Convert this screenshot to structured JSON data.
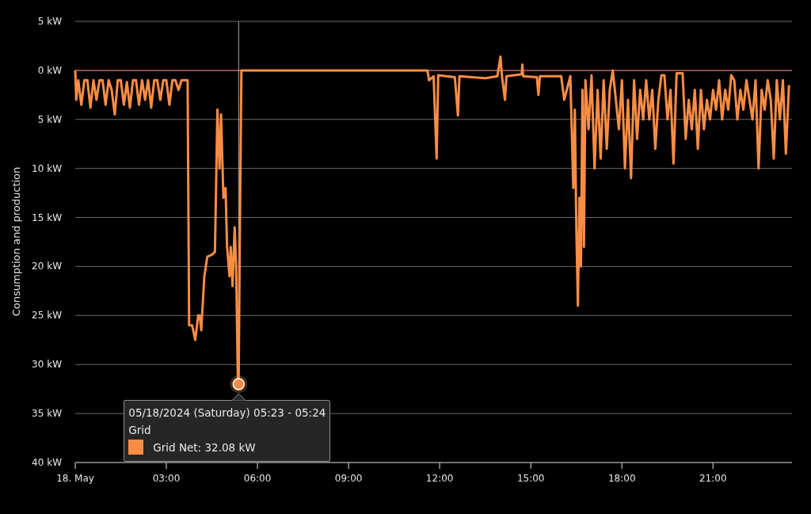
{
  "chart_data": {
    "type": "line",
    "ylabel": "Consumption and production",
    "xlim": [
      0,
      23.6
    ],
    "ylim": [
      -40,
      5
    ],
    "grid": true,
    "ref_lines": [
      {
        "axis": "y",
        "value": 0,
        "color": "#b25252"
      },
      {
        "axis": "x",
        "value": 5.38,
        "color": "#aaaaaa"
      }
    ],
    "xticks": [
      {
        "value": 0,
        "label": "18. May"
      },
      {
        "value": 3,
        "label": "03:00"
      },
      {
        "value": 6,
        "label": "06:00"
      },
      {
        "value": 9,
        "label": "09:00"
      },
      {
        "value": 12,
        "label": "12:00"
      },
      {
        "value": 15,
        "label": "15:00"
      },
      {
        "value": 18,
        "label": "18:00"
      },
      {
        "value": 21,
        "label": "21:00"
      }
    ],
    "yticks": [
      {
        "value": 5,
        "label": "5 kW"
      },
      {
        "value": 0,
        "label": "0 kW"
      },
      {
        "value": -5,
        "label": "5 kW"
      },
      {
        "value": -10,
        "label": "10 kW"
      },
      {
        "value": -15,
        "label": "15 kW"
      },
      {
        "value": -20,
        "label": "20 kW"
      },
      {
        "value": -25,
        "label": "25 kW"
      },
      {
        "value": -30,
        "label": "30 kW"
      },
      {
        "value": -35,
        "label": "35 kW"
      },
      {
        "value": -40,
        "label": "40 kW"
      }
    ],
    "x": [
      0,
      0.03,
      0.1,
      0.2,
      0.3,
      0.4,
      0.5,
      0.6,
      0.7,
      0.8,
      0.9,
      1.0,
      1.1,
      1.2,
      1.3,
      1.4,
      1.5,
      1.6,
      1.7,
      1.8,
      1.9,
      2.0,
      2.1,
      2.2,
      2.3,
      2.4,
      2.5,
      2.6,
      2.7,
      2.8,
      2.9,
      3.0,
      3.1,
      3.2,
      3.3,
      3.4,
      3.5,
      3.6,
      3.7,
      3.75,
      3.85,
      3.95,
      4.05,
      4.1,
      4.15,
      4.25,
      4.35,
      4.5,
      4.6,
      4.68,
      4.75,
      4.8,
      4.88,
      4.95,
      5.0,
      5.08,
      5.12,
      5.18,
      5.25,
      5.3,
      5.35,
      5.38,
      5.42,
      5.47,
      11.6,
      11.65,
      11.8,
      11.9,
      11.95,
      12.5,
      12.6,
      12.65,
      13.5,
      13.9,
      14.0,
      14.05,
      14.15,
      14.2,
      14.7,
      14.72,
      14.75,
      15.2,
      15.25,
      15.3,
      16.0,
      16.1,
      16.3,
      16.4,
      16.45,
      16.5,
      16.55,
      16.6,
      16.65,
      16.7,
      16.75,
      16.8,
      16.9,
      17.0,
      17.1,
      17.2,
      17.3,
      17.4,
      17.5,
      17.6,
      17.7,
      17.8,
      17.9,
      18.0,
      18.1,
      18.2,
      18.3,
      18.4,
      18.5,
      18.6,
      18.7,
      18.8,
      18.9,
      19.0,
      19.1,
      19.2,
      19.3,
      19.4,
      19.5,
      19.6,
      19.7,
      19.8,
      20.0,
      20.1,
      20.2,
      20.3,
      20.4,
      20.5,
      20.6,
      20.7,
      20.8,
      20.9,
      21.0,
      21.1,
      21.2,
      21.3,
      21.4,
      21.5,
      21.6,
      21.7,
      21.8,
      21.9,
      22.0,
      22.1,
      22.2,
      22.3,
      22.4,
      22.5,
      22.6,
      22.7,
      22.8,
      22.9,
      23.0,
      23.1,
      23.2,
      23.3,
      23.4,
      23.5
    ],
    "series": [
      {
        "name": "Grid Net",
        "color": "#f98d45",
        "values": [
          0,
          -3,
          -1,
          -3.5,
          -1,
          -1,
          -3.8,
          -1,
          -3,
          -1,
          -1,
          -3.5,
          -1,
          -2,
          -4.5,
          -1,
          -1,
          -3.5,
          -1.2,
          -3.8,
          -1,
          -1,
          -3.5,
          -1,
          -3,
          -1,
          -3.8,
          -1,
          -1,
          -3,
          -1,
          -1,
          -3.5,
          -1,
          -1,
          -2,
          -1,
          -1,
          -1,
          -26,
          -26,
          -27.5,
          -25,
          -25,
          -26.5,
          -21,
          -19,
          -18.8,
          -18.5,
          -4,
          -10,
          -4.5,
          -13,
          -12,
          -18,
          -21,
          -18,
          -22,
          -16,
          -20,
          -31,
          -32,
          -17,
          0,
          0,
          -1,
          -0.6,
          -9,
          -0.5,
          -0.7,
          -4.6,
          -0.6,
          -0.8,
          -0.6,
          1.4,
          -0.6,
          -3,
          -0.6,
          -0.4,
          0.6,
          -0.6,
          -0.7,
          -2.5,
          -0.6,
          -0.6,
          -3,
          -0.6,
          -12,
          -4,
          -16,
          -24,
          -13,
          -20,
          -2,
          -18,
          -1,
          -6,
          -0.5,
          -10,
          -2,
          -9,
          -1,
          -8,
          -2,
          0,
          -3,
          -6,
          -1,
          -10,
          -3,
          -11,
          -1,
          -7,
          -2,
          -5,
          -1,
          -5,
          -2,
          -8,
          -3,
          -0.5,
          -0.5,
          -5,
          -2,
          -9.5,
          -0.3,
          -0.3,
          -7,
          -3,
          -6,
          -2,
          -8,
          -2,
          -6,
          -3,
          -5,
          -2,
          -4,
          -1,
          -5,
          -2,
          -4,
          -0.5,
          -1,
          -5,
          -2,
          -4,
          -1,
          -3,
          -5,
          -1,
          -10,
          -2,
          -4,
          -1,
          -3,
          -9,
          -1,
          -5,
          -1,
          -8.5,
          -1.5
        ]
      }
    ]
  },
  "tooltip": {
    "title": "05/18/2024 (Saturday) 05:23 - 05:24",
    "group": "Grid",
    "value": ": 32.08 kW"
  }
}
